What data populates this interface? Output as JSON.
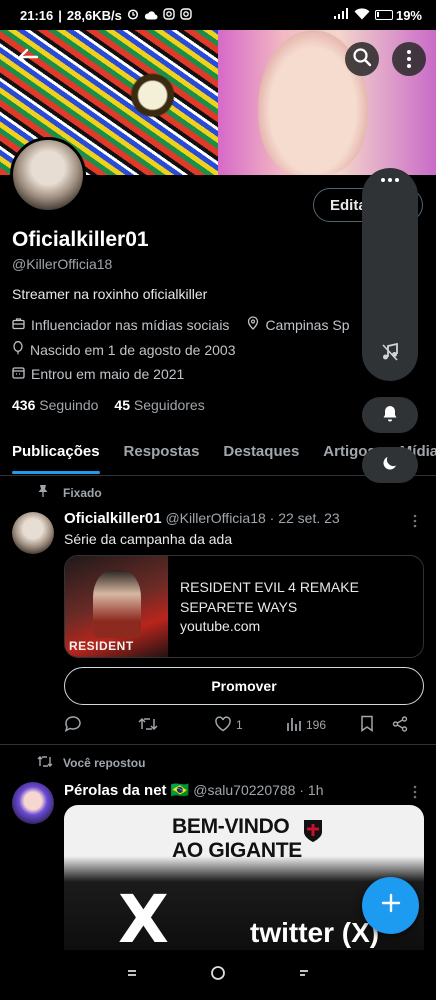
{
  "status_bar": {
    "time": "21:16",
    "speed": "28,6KB/s",
    "battery": "19%",
    "battery_level": 0.19
  },
  "profile": {
    "edit_label": "Edita",
    "name": "Oficialkiller01",
    "handle": "@KillerOfficia18",
    "bio": "Streamer na  roxinho oficialkiller",
    "category": "Influenciador nas mídias sociais",
    "location": "Campinas Sp",
    "birth": "Nascido em 1 de agosto de 2003",
    "joined": "Entrou em maio de 2021",
    "following_count": "436",
    "following_label": "Seguindo",
    "followers_count": "45",
    "followers_label": "Seguidores"
  },
  "tabs": [
    {
      "label": "Publicações"
    },
    {
      "label": "Respostas"
    },
    {
      "label": "Destaques"
    },
    {
      "label": "Artigos"
    },
    {
      "label": "Mídia"
    }
  ],
  "pinned_post": {
    "pinned_label": "Fixado",
    "author": "Oficialkiller01",
    "meta": "@KillerOfficia18 · 22 set. 23",
    "text": "Série da campanha da ada",
    "card_thumb_text": "RESIDENT",
    "card_title": "RESIDENT EVIL 4 REMAKE SEPARETE WAYS",
    "card_domain": "youtube.com",
    "promote_label": "Promover",
    "likes": "1",
    "views": "196"
  },
  "repost": {
    "repost_label": "Você repostou",
    "author": "Pérolas da net 🇧🇷",
    "meta": "@salu70220788 · 1h",
    "media_title_1": "BEM-VINDO",
    "media_title_2": "AO GIGANTE",
    "media_logo": "X",
    "media_caption": "twitter (X)"
  },
  "colors": {
    "accent": "#1d9bf0",
    "background": "#000000"
  }
}
